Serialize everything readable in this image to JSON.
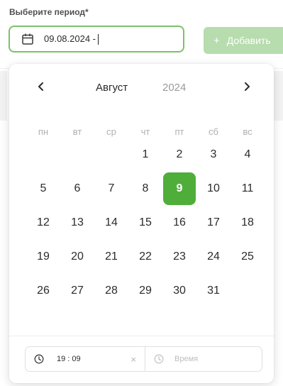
{
  "form": {
    "period_label": "Выберите период",
    "required_mark": "*",
    "date_value": "09.08.2024 -",
    "add_button_label": "Добавить"
  },
  "calendar": {
    "month": "Август",
    "year": "2024",
    "weekdays": [
      "пн",
      "вт",
      "ср",
      "чт",
      "пт",
      "сб",
      "вс"
    ],
    "first_weekday_index": 3,
    "days_in_month": 31,
    "selected_day": 9,
    "accent_color": "#4fae3a"
  },
  "time": {
    "start_value": "19 : 09",
    "clear_symbol": "×",
    "end_placeholder": "Время"
  },
  "icons": {
    "calendar": "calendar-icon",
    "prev": "chevron-left-icon",
    "next": "chevron-right-icon",
    "clock": "clock-icon",
    "plus": "plus-icon",
    "clear": "close-icon"
  }
}
